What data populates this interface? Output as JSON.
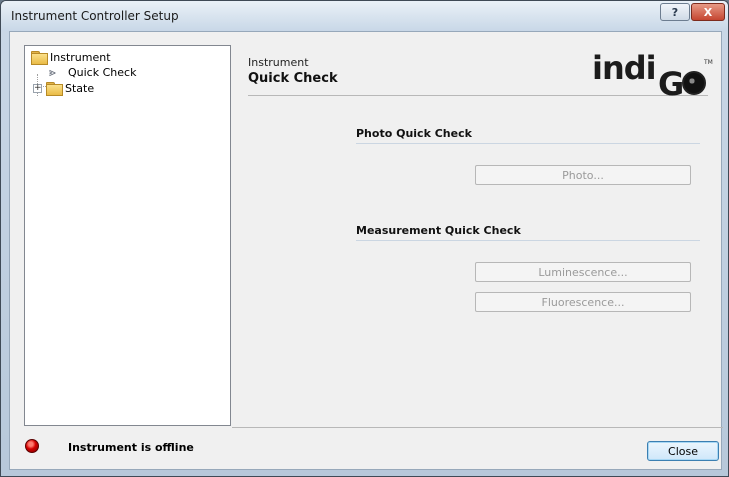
{
  "window": {
    "title": "Instrument Controller Setup",
    "help_label": "?",
    "close_label": "X"
  },
  "tree": {
    "items": [
      {
        "label": "Instrument",
        "icon": "folder-icon"
      },
      {
        "label": "Quick Check",
        "icon": "arrow-icon"
      },
      {
        "label": "State",
        "icon": "folder-icon",
        "expander": "+"
      }
    ]
  },
  "header": {
    "kicker": "Instrument",
    "title": "Quick Check"
  },
  "logo": {
    "text_main": "indi",
    "text_mark": "G",
    "tm": "TM"
  },
  "groups": {
    "photo": {
      "title": "Photo Quick Check",
      "buttons": [
        "Photo..."
      ]
    },
    "measurement": {
      "title": "Measurement Quick Check",
      "buttons": [
        "Luminescence...",
        "Fluorescence..."
      ]
    }
  },
  "footer": {
    "status_text": "Instrument is offline",
    "close_label": "Close"
  },
  "colors": {
    "status_led": "#d40000",
    "button_disabled_text": "#9a9a9a"
  }
}
